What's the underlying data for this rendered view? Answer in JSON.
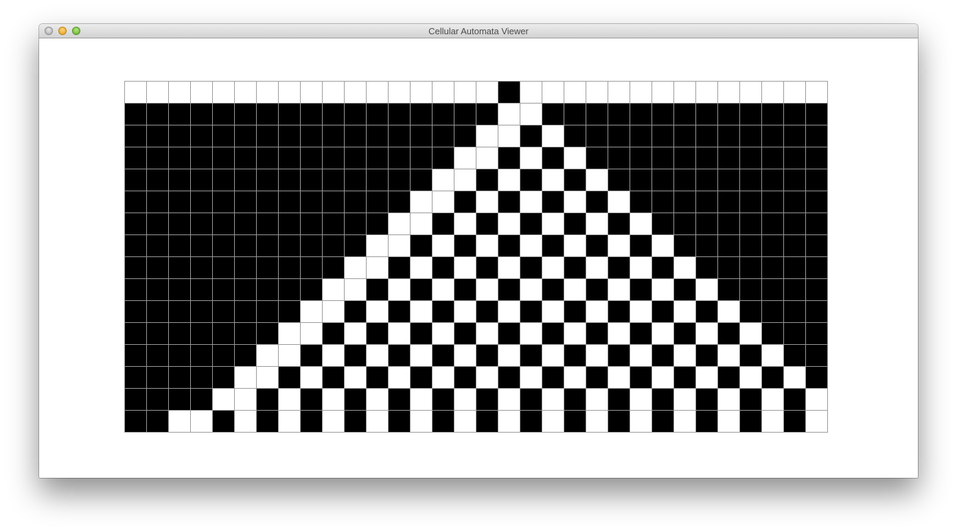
{
  "window": {
    "title": "Cellular Automata Viewer",
    "buttons": [
      "close",
      "minimize",
      "zoom"
    ]
  },
  "automaton": {
    "columns": 32,
    "generations": 16,
    "colors": {
      "alive": "#000000",
      "dead": "#ffffff",
      "gridline": "#9a9a9a"
    },
    "rows": [
      "00000000000000000100000000000000",
      "11111111111111111001111111111111",
      "11111111111111110010111111111111",
      "11111111111111100101011111111111",
      "11111111111111001010101111111111",
      "11111111111110010101010111111111",
      "11111111111100101010101011111111",
      "11111111111001010101010101111111",
      "11111111110010101010101010111111",
      "11111111100101010101010101011111",
      "11111111001010101010101010101111",
      "11111110010101010101010101010111",
      "11111100101010101010101010101011",
      "11111001010101010101010101010101",
      "11110010101010101010101010101010",
      "11001010101010101010101010101010"
    ]
  }
}
